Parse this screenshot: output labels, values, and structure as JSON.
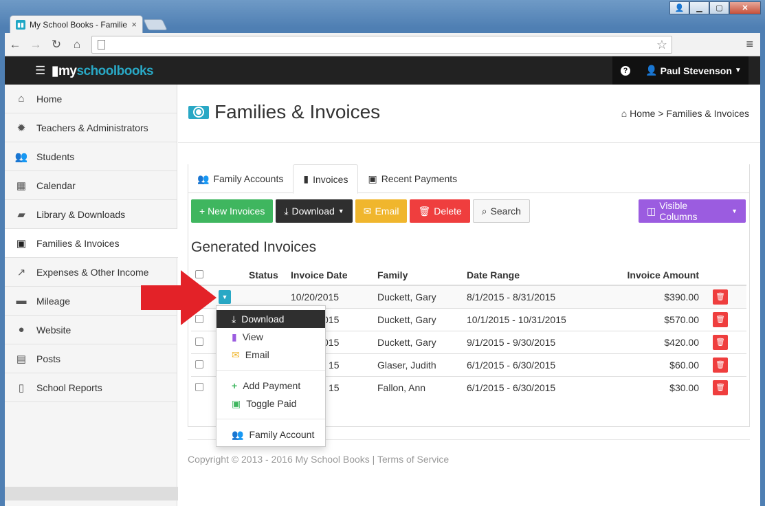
{
  "browser": {
    "tab_title": "My School Books - Familie",
    "tab_close": "×",
    "controls": {
      "min": "▁",
      "max": "▢",
      "close": "✕"
    }
  },
  "app": {
    "logo_my": "my",
    "logo_sb": "schoolbooks",
    "help": "?",
    "user": "Paul Stevenson"
  },
  "sidebar": {
    "items": [
      {
        "label": "Home",
        "icon": "home-icon"
      },
      {
        "label": "Teachers & Administrators",
        "icon": "gear-icon"
      },
      {
        "label": "Students",
        "icon": "users-icon"
      },
      {
        "label": "Calendar",
        "icon": "calendar-icon"
      },
      {
        "label": "Library & Downloads",
        "icon": "book-icon"
      },
      {
        "label": "Families & Invoices",
        "icon": "money-icon"
      },
      {
        "label": "Expenses & Other Income",
        "icon": "chart-icon"
      },
      {
        "label": "Mileage",
        "icon": "car-icon"
      },
      {
        "label": "Website",
        "icon": "globe-icon"
      },
      {
        "label": "Posts",
        "icon": "newspaper-icon"
      },
      {
        "label": "School Reports",
        "icon": "file-icon"
      }
    ]
  },
  "page": {
    "title": "Families & Invoices",
    "breadcrumb": "Home > Families & Invoices"
  },
  "tabs": [
    "Family Accounts",
    "Invoices",
    "Recent Payments"
  ],
  "buttons": {
    "new": "+ New Invoices",
    "download": "Download",
    "email": "Email",
    "delete": "Delete",
    "search": "Search",
    "visible": "Visible Columns"
  },
  "section_title": "Generated Invoices",
  "table": {
    "headers": [
      "Status",
      "Invoice Date",
      "Family",
      "Date Range",
      "Invoice Amount"
    ],
    "rows": [
      {
        "date": "10/20/2015",
        "family": "Duckett, Gary",
        "range": "8/1/2015 - 8/31/2015",
        "amount": "$390.00"
      },
      {
        "date": "015",
        "family": "Duckett, Gary",
        "range": "10/1/2015 - 10/31/2015",
        "amount": "$570.00"
      },
      {
        "date": "015",
        "family": "Duckett, Gary",
        "range": "9/1/2015 - 9/30/2015",
        "amount": "$420.00"
      },
      {
        "date": "15",
        "family": "Glaser, Judith",
        "range": "6/1/2015 - 6/30/2015",
        "amount": "$60.00"
      },
      {
        "date": "15",
        "family": "Fallon, Ann",
        "range": "6/1/2015 - 6/30/2015",
        "amount": "$30.00"
      }
    ]
  },
  "dropdown": {
    "items": [
      "Download",
      "View",
      "Email",
      "Add Payment",
      "Toggle Paid",
      "Family Account"
    ]
  },
  "footer": "Copyright © 2013 - 2016 My School Books | Terms of Service",
  "colors": {
    "accent": "#29a8c5",
    "arrow": "#e32228"
  }
}
